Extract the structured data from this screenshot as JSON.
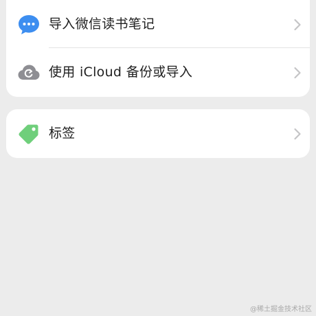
{
  "menu": {
    "items": [
      {
        "label": "导入微信读书笔记",
        "icon": "chat-bubble-icon",
        "color": "#3d8ef0"
      },
      {
        "label": "使用 iCloud 备份或导入",
        "icon": "cloud-sync-icon",
        "color": "#8e8e93"
      }
    ]
  },
  "tags": {
    "label": "标签",
    "icon": "tag-icon",
    "color": "#6fcf7b"
  },
  "chevron_color": "#c4c4c6",
  "watermark": "@稀土掘金技术社区"
}
